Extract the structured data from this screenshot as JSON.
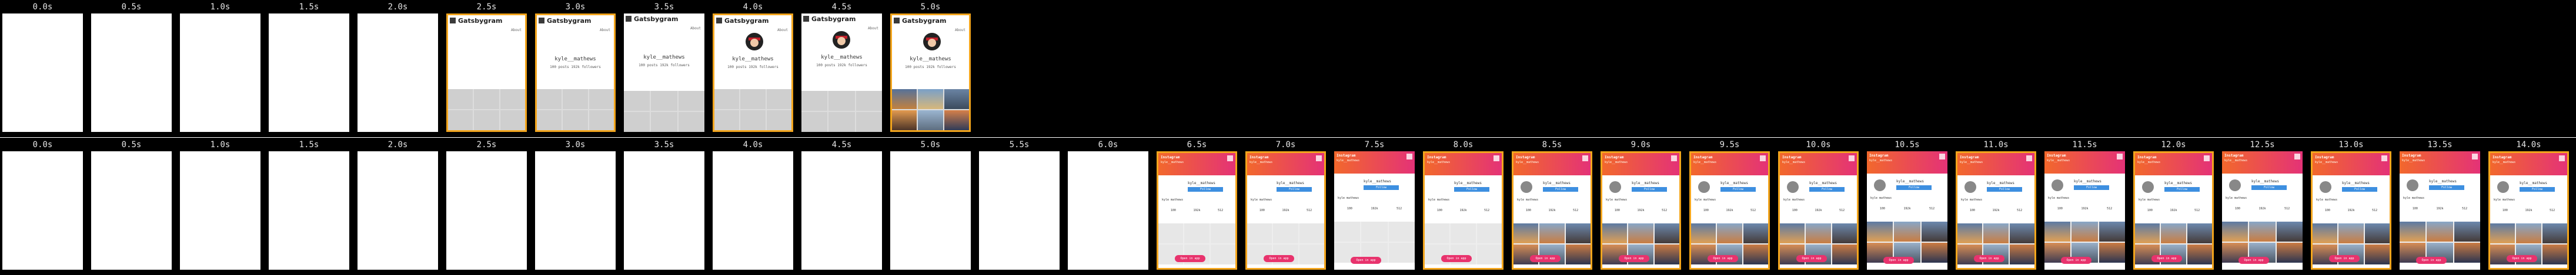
{
  "strip1": {
    "app_title": "Gatsbygram",
    "about_label": "About",
    "username": "kyle__mathews",
    "stats_posts": "100 posts",
    "stats_followers": "192k followers",
    "frames": [
      {
        "time": "0.0s",
        "state": "blank"
      },
      {
        "time": "0.5s",
        "state": "blank"
      },
      {
        "time": "1.0s",
        "state": "blank"
      },
      {
        "time": "1.5s",
        "state": "blank"
      },
      {
        "time": "2.0s",
        "state": "blank"
      },
      {
        "time": "2.5s",
        "state": "header-grid",
        "highlight": true
      },
      {
        "time": "3.0s",
        "state": "profile",
        "highlight": true
      },
      {
        "time": "3.5s",
        "state": "profile",
        "highlight": false
      },
      {
        "time": "4.0s",
        "state": "profile-avatar",
        "highlight": true
      },
      {
        "time": "4.5s",
        "state": "profile-avatar",
        "highlight": false
      },
      {
        "time": "5.0s",
        "state": "full",
        "highlight": true
      }
    ]
  },
  "strip2": {
    "header_title": "Instagram",
    "header_subtitle": "kyle__mathews",
    "menu_label": "Gatsby Gram",
    "profile_name": "kyle__mathews",
    "follow_label": "Follow",
    "info_text": "kyle mathews",
    "stats": [
      "100",
      "192k",
      "512"
    ],
    "pill_label": "Open in app",
    "frames": [
      {
        "time": "0.0s",
        "state": "blank"
      },
      {
        "time": "0.5s",
        "state": "blank"
      },
      {
        "time": "1.0s",
        "state": "blank"
      },
      {
        "time": "1.5s",
        "state": "blank"
      },
      {
        "time": "2.0s",
        "state": "blank"
      },
      {
        "time": "2.5s",
        "state": "blank"
      },
      {
        "time": "3.0s",
        "state": "blank"
      },
      {
        "time": "3.5s",
        "state": "blank"
      },
      {
        "time": "4.0s",
        "state": "blank"
      },
      {
        "time": "4.5s",
        "state": "blank"
      },
      {
        "time": "5.0s",
        "state": "blank"
      },
      {
        "time": "5.5s",
        "state": "blank"
      },
      {
        "time": "6.0s",
        "state": "blank"
      },
      {
        "time": "6.5s",
        "state": "layout",
        "highlight": true
      },
      {
        "time": "7.0s",
        "state": "layout",
        "highlight": true
      },
      {
        "time": "7.5s",
        "state": "layout",
        "highlight": false
      },
      {
        "time": "8.0s",
        "state": "layout",
        "highlight": true
      },
      {
        "time": "8.5s",
        "state": "layout-photo",
        "highlight": true
      },
      {
        "time": "9.0s",
        "state": "layout-photo",
        "highlight": true
      },
      {
        "time": "9.5s",
        "state": "full",
        "highlight": true
      },
      {
        "time": "10.0s",
        "state": "full",
        "highlight": true
      },
      {
        "time": "10.5s",
        "state": "full",
        "highlight": false
      },
      {
        "time": "11.0s",
        "state": "full",
        "highlight": true
      },
      {
        "time": "11.5s",
        "state": "full",
        "highlight": false
      },
      {
        "time": "12.0s",
        "state": "full",
        "highlight": true
      },
      {
        "time": "12.5s",
        "state": "full",
        "highlight": false
      },
      {
        "time": "13.0s",
        "state": "full",
        "highlight": true
      },
      {
        "time": "13.5s",
        "state": "full",
        "highlight": false
      },
      {
        "time": "14.0s",
        "state": "full",
        "highlight": true
      }
    ]
  },
  "colors": {
    "background": "#000000",
    "highlight": "#f3a51c",
    "label": "#e6e6e6",
    "header_gradient_start": "#f2682c",
    "header_gradient_end": "#e43277",
    "follow_button": "#3d8fe0",
    "pill": "#e8336d"
  }
}
